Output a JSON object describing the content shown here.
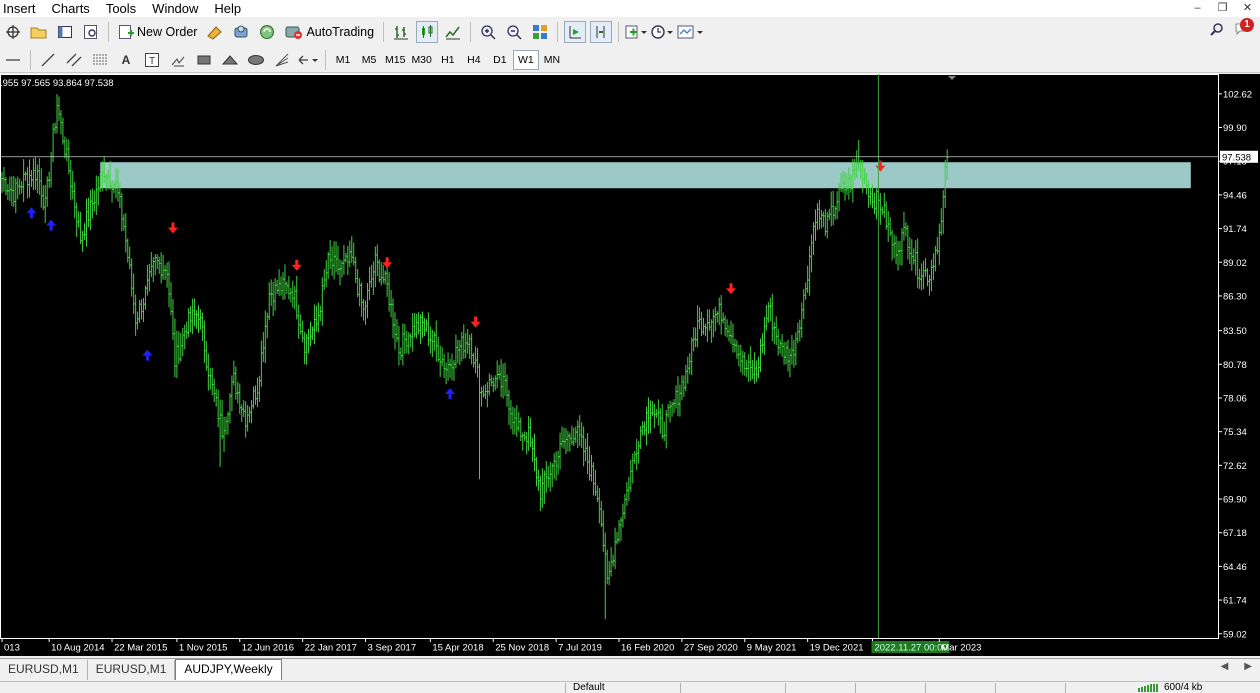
{
  "menu": [
    "Insert",
    "Charts",
    "Tools",
    "Window",
    "Help"
  ],
  "toolbar": {
    "new_order": "New Order",
    "autotrading": "AutoTrading"
  },
  "timeframes": [
    "M1",
    "M5",
    "M15",
    "M30",
    "H1",
    "H4",
    "D1",
    "W1",
    "MN"
  ],
  "active_timeframe": "W1",
  "notification_count": "1",
  "ohlc_text": ".955 97.565 93.864 97.538",
  "tabs": [
    "EURUSD,M1",
    "EURUSD,M1",
    "AUDJPY,Weekly"
  ],
  "active_tab": "AUDJPY,Weekly",
  "status": {
    "profile": "Default",
    "traffic": "600/4 kb"
  },
  "colors": {
    "background": "#000000",
    "bars": "#3fd13f",
    "zone": "#9cc8c8",
    "sell_arrow": "#ff2020",
    "buy_arrow": "#2020ff",
    "price_label_bg": "#ffffff"
  },
  "chart_data": {
    "type": "bar",
    "symbol": "AUDJPY",
    "timeframe": "Weekly",
    "ylim": [
      59.0,
      103.9
    ],
    "y_ticks": [
      102.62,
      99.9,
      97.18,
      94.46,
      91.74,
      89.02,
      86.3,
      83.5,
      80.78,
      78.06,
      75.34,
      72.62,
      69.9,
      67.18,
      64.46,
      61.74,
      59.02
    ],
    "x_ticks": [
      {
        "idx": 0,
        "label": "013"
      },
      {
        "idx": 24,
        "label": "10 Aug 2014"
      },
      {
        "idx": 56,
        "label": "22 Mar 2015"
      },
      {
        "idx": 89,
        "label": "1 Nov 2015"
      },
      {
        "idx": 121,
        "label": "12 Jun 2016"
      },
      {
        "idx": 153,
        "label": "22 Jan 2017"
      },
      {
        "idx": 185,
        "label": "3 Sep 2017"
      },
      {
        "idx": 218,
        "label": "15 Apr 2018"
      },
      {
        "idx": 250,
        "label": "25 Nov 2018"
      },
      {
        "idx": 282,
        "label": "7 Jul 2019"
      },
      {
        "idx": 314,
        "label": "16 Feb 2020"
      },
      {
        "idx": 346,
        "label": "27 Sep 2020"
      },
      {
        "idx": 378,
        "label": "9 May 2021"
      },
      {
        "idx": 410,
        "label": "19 Dec 2021"
      },
      {
        "idx": 443,
        "label": "2022.11.27 00:00"
      },
      {
        "idx": 477,
        "label": "Mar 2023"
      }
    ],
    "highlight_x_label": "2022.11.27 00:00",
    "crosshair_idx": 446,
    "current_price": 97.538,
    "current_price_label": "97.538",
    "zone": {
      "from_idx": 50,
      "to_idx": 605,
      "low": 95.0,
      "high": 97.1
    },
    "anchors": [
      {
        "i": 0,
        "v": 95.8
      },
      {
        "i": 6,
        "v": 94.6
      },
      {
        "i": 12,
        "v": 95.9
      },
      {
        "i": 18,
        "v": 96.3
      },
      {
        "i": 22,
        "v": 93.5
      },
      {
        "i": 28,
        "v": 101.8
      },
      {
        "i": 34,
        "v": 96.5
      },
      {
        "i": 40,
        "v": 91.0
      },
      {
        "i": 46,
        "v": 93.8
      },
      {
        "i": 52,
        "v": 96.5
      },
      {
        "i": 58,
        "v": 95.2
      },
      {
        "i": 62,
        "v": 92.0
      },
      {
        "i": 68,
        "v": 84.5
      },
      {
        "i": 72,
        "v": 86.0
      },
      {
        "i": 78,
        "v": 89.0
      },
      {
        "i": 84,
        "v": 88.5
      },
      {
        "i": 88,
        "v": 81.0
      },
      {
        "i": 94,
        "v": 84.0
      },
      {
        "i": 100,
        "v": 85.0
      },
      {
        "i": 106,
        "v": 79.5
      },
      {
        "i": 112,
        "v": 75.5
      },
      {
        "i": 118,
        "v": 79.5
      },
      {
        "i": 124,
        "v": 76.5
      },
      {
        "i": 130,
        "v": 79.0
      },
      {
        "i": 136,
        "v": 86.5
      },
      {
        "i": 142,
        "v": 87.0
      },
      {
        "i": 148,
        "v": 86.8
      },
      {
        "i": 154,
        "v": 82.5
      },
      {
        "i": 160,
        "v": 84.0
      },
      {
        "i": 166,
        "v": 89.0
      },
      {
        "i": 172,
        "v": 88.5
      },
      {
        "i": 178,
        "v": 89.2
      },
      {
        "i": 184,
        "v": 85.0
      },
      {
        "i": 190,
        "v": 89.0
      },
      {
        "i": 196,
        "v": 87.0
      },
      {
        "i": 202,
        "v": 82.0
      },
      {
        "i": 208,
        "v": 83.5
      },
      {
        "i": 214,
        "v": 84.0
      },
      {
        "i": 220,
        "v": 82.5
      },
      {
        "i": 226,
        "v": 80.5
      },
      {
        "i": 232,
        "v": 82.0
      },
      {
        "i": 238,
        "v": 83.0
      },
      {
        "i": 244,
        "v": 78.5
      },
      {
        "i": 250,
        "v": 79.5
      },
      {
        "i": 256,
        "v": 79.0
      },
      {
        "i": 262,
        "v": 75.5
      },
      {
        "i": 268,
        "v": 75.0
      },
      {
        "i": 274,
        "v": 70.5
      },
      {
        "i": 280,
        "v": 72.5
      },
      {
        "i": 286,
        "v": 74.5
      },
      {
        "i": 292,
        "v": 75.5
      },
      {
        "i": 298,
        "v": 73.0
      },
      {
        "i": 304,
        "v": 69.8
      },
      {
        "i": 308,
        "v": 63.0
      },
      {
        "i": 312,
        "v": 66.5
      },
      {
        "i": 318,
        "v": 70.5
      },
      {
        "i": 324,
        "v": 75.0
      },
      {
        "i": 330,
        "v": 77.5
      },
      {
        "i": 336,
        "v": 75.5
      },
      {
        "i": 342,
        "v": 77.5
      },
      {
        "i": 348,
        "v": 80.0
      },
      {
        "i": 354,
        "v": 84.0
      },
      {
        "i": 360,
        "v": 84.5
      },
      {
        "i": 366,
        "v": 85.0
      },
      {
        "i": 372,
        "v": 83.0
      },
      {
        "i": 378,
        "v": 80.5
      },
      {
        "i": 384,
        "v": 80.0
      },
      {
        "i": 390,
        "v": 85.5
      },
      {
        "i": 396,
        "v": 82.0
      },
      {
        "i": 402,
        "v": 81.5
      },
      {
        "i": 408,
        "v": 86.0
      },
      {
        "i": 414,
        "v": 93.0
      },
      {
        "i": 420,
        "v": 92.0
      },
      {
        "i": 426,
        "v": 94.5
      },
      {
        "i": 432,
        "v": 95.5
      },
      {
        "i": 436,
        "v": 97.3
      },
      {
        "i": 442,
        "v": 94.5
      },
      {
        "i": 448,
        "v": 93.5
      },
      {
        "i": 454,
        "v": 90.0
      },
      {
        "i": 460,
        "v": 91.5
      },
      {
        "i": 466,
        "v": 88.5
      },
      {
        "i": 472,
        "v": 88.0
      },
      {
        "i": 478,
        "v": 92.0
      },
      {
        "i": 480,
        "v": 96.0
      },
      {
        "i": 481,
        "v": 97.5
      }
    ],
    "spikes": [
      {
        "i": 28,
        "v": 102.6
      },
      {
        "i": 111,
        "v": 72.5
      },
      {
        "i": 243,
        "v": 71.5
      },
      {
        "i": 276,
        "v": 69.5
      },
      {
        "i": 307,
        "v": 60.2
      },
      {
        "i": 436,
        "v": 98.9
      }
    ],
    "sell_arrows": [
      {
        "i": 87,
        "v": 91.5
      },
      {
        "i": 150,
        "v": 88.5
      },
      {
        "i": 196,
        "v": 88.7
      },
      {
        "i": 241,
        "v": 83.9
      },
      {
        "i": 371,
        "v": 86.6
      },
      {
        "i": 447,
        "v": 96.5
      }
    ],
    "buy_arrows": [
      {
        "i": 15,
        "v": 93.3
      },
      {
        "i": 25,
        "v": 92.3
      },
      {
        "i": 74,
        "v": 81.8
      },
      {
        "i": 228,
        "v": 78.7
      }
    ]
  }
}
